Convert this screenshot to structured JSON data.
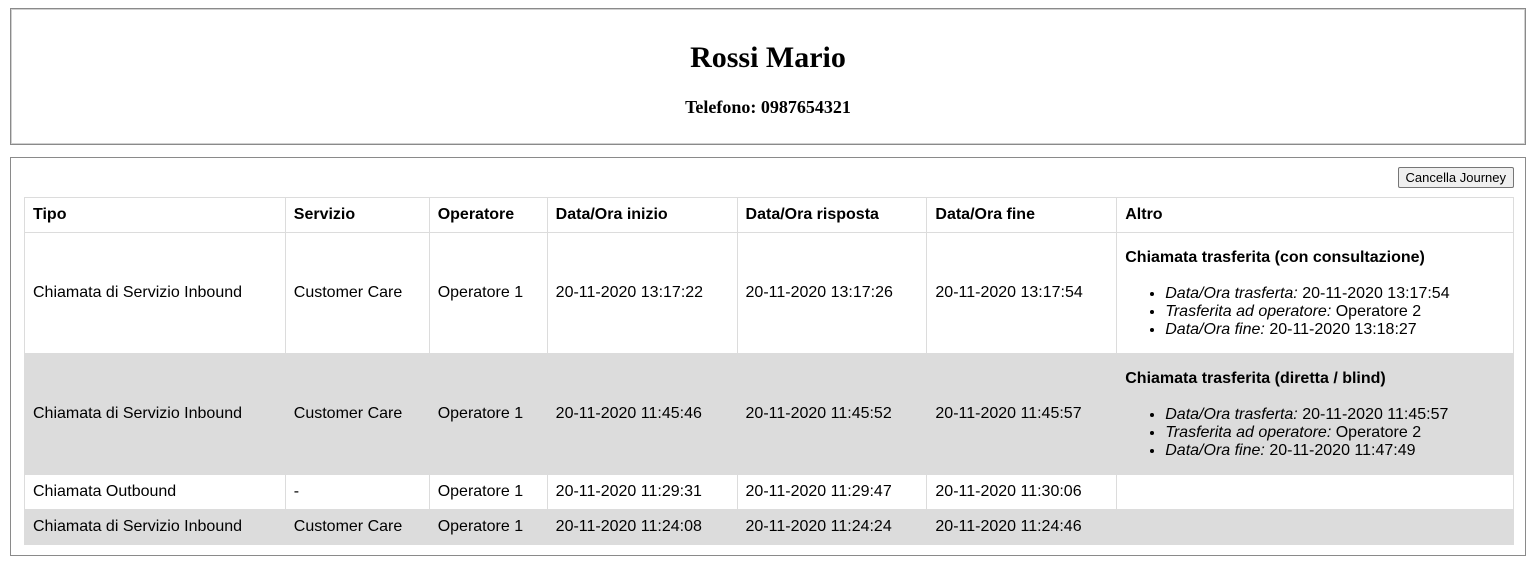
{
  "header": {
    "name": "Rossi Mario",
    "phone_label": "Telefono:",
    "phone_value": "0987654321"
  },
  "journey": {
    "cancel_label": "Cancella Journey",
    "columns": [
      "Tipo",
      "Servizio",
      "Operatore",
      "Data/Ora inizio",
      "Data/Ora risposta",
      "Data/Ora fine",
      "Altro"
    ],
    "rows": [
      {
        "tipo": "Chiamata di Servizio Inbound",
        "servizio": "Customer Care",
        "operatore": "Operatore 1",
        "inizio": "20-11-2020 13:17:22",
        "risposta": "20-11-2020 13:17:26",
        "fine": "20-11-2020 13:17:54",
        "altro": {
          "title": "Chiamata trasferita (con consultazione)",
          "items": [
            {
              "label": "Data/Ora trasferta:",
              "value": "20-11-2020 13:17:54"
            },
            {
              "label": "Trasferita ad operatore:",
              "value": "Operatore 2"
            },
            {
              "label": "Data/Ora fine:",
              "value": "20-11-2020 13:18:27"
            }
          ]
        }
      },
      {
        "tipo": "Chiamata di Servizio Inbound",
        "servizio": "Customer Care",
        "operatore": "Operatore 1",
        "inizio": "20-11-2020 11:45:46",
        "risposta": "20-11-2020 11:45:52",
        "fine": "20-11-2020 11:45:57",
        "altro": {
          "title": "Chiamata trasferita (diretta / blind)",
          "items": [
            {
              "label": "Data/Ora trasferta:",
              "value": "20-11-2020 11:45:57"
            },
            {
              "label": "Trasferita ad operatore:",
              "value": "Operatore 2"
            },
            {
              "label": "Data/Ora fine:",
              "value": "20-11-2020 11:47:49"
            }
          ]
        }
      },
      {
        "tipo": "Chiamata Outbound",
        "servizio": "-",
        "operatore": "Operatore 1",
        "inizio": "20-11-2020 11:29:31",
        "risposta": "20-11-2020 11:29:47",
        "fine": "20-11-2020 11:30:06",
        "altro": null
      },
      {
        "tipo": "Chiamata di Servizio Inbound",
        "servizio": "Customer Care",
        "operatore": "Operatore 1",
        "inizio": "20-11-2020 11:24:08",
        "risposta": "20-11-2020 11:24:24",
        "fine": "20-11-2020 11:24:46",
        "altro": null
      }
    ]
  }
}
